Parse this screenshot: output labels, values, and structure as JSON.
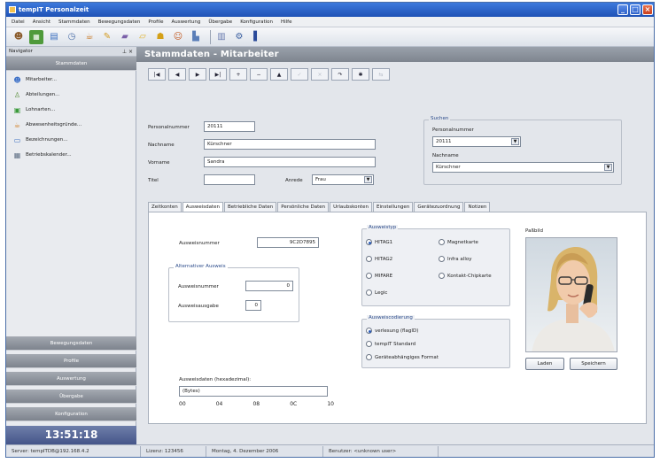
{
  "window": {
    "title": "tempIT Personalzeit",
    "controls": {
      "minimize": "_",
      "maximize": "□",
      "close": "×"
    }
  },
  "menu": [
    "Datei",
    "Ansicht",
    "Stammdaten",
    "Bewegungsdaten",
    "Profile",
    "Auswertung",
    "Übergabe",
    "Konfiguration",
    "Hilfe"
  ],
  "toolbar": {
    "icons": [
      "users-icon",
      "calendar-icon",
      "document-icon",
      "clock-icon",
      "coffee-icon",
      "pen-icon",
      "folder-icon",
      "folder-open-icon",
      "lock-icon",
      "people-icon",
      "chart-icon",
      "spacer-icon",
      "book-icon",
      "help-icon"
    ]
  },
  "navigator": {
    "header": "Navigator",
    "pin": "⊥ ×",
    "stammdaten_group": "Stammdaten",
    "items": [
      {
        "label": "Mitarbeiter...",
        "icon": "people-icon",
        "color": "#3b6fc7"
      },
      {
        "label": "Abteilungen...",
        "icon": "person-icon",
        "color": "#5a8f3c"
      },
      {
        "label": "Lohnarten...",
        "icon": "ledger-icon",
        "color": "#3a9a3a"
      },
      {
        "label": "Abwesenheitsgründe...",
        "icon": "absence-icon",
        "color": "#d07a1c"
      },
      {
        "label": "Bezeichnungen...",
        "icon": "label-icon",
        "color": "#3a6fc0"
      },
      {
        "label": "Betriebskalender...",
        "icon": "calendar-icon",
        "color": "#607086"
      }
    ],
    "groups": [
      "Bewegungsdaten",
      "Profile",
      "Auswertung",
      "Übergabe",
      "Konfiguration"
    ],
    "clock": "13:51:18"
  },
  "main": {
    "title": "Stammdaten - Mitarbeiter",
    "record_nav": [
      {
        "symbol": "|◀",
        "enabled": true
      },
      {
        "symbol": "◀",
        "enabled": true
      },
      {
        "symbol": "▶",
        "enabled": true
      },
      {
        "symbol": "▶|",
        "enabled": true
      },
      {
        "symbol": "+",
        "enabled": true
      },
      {
        "symbol": "−",
        "enabled": true
      },
      {
        "symbol": "▲",
        "enabled": true
      },
      {
        "symbol": "✓",
        "enabled": false
      },
      {
        "symbol": "×",
        "enabled": false
      },
      {
        "symbol": "↷",
        "enabled": true
      },
      {
        "symbol": "✱",
        "enabled": true
      },
      {
        "symbol": "⇆",
        "enabled": false
      }
    ],
    "form": {
      "personalnummer_label": "Personalnummer",
      "personalnummer": "20111",
      "nachname_label": "Nachname",
      "nachname": "Kürschner",
      "vorname_label": "Vorname",
      "vorname": "Sandra",
      "titel_label": "Titel",
      "titel": "",
      "anrede_label": "Anrede",
      "anrede": "Frau"
    },
    "suchen": {
      "title": "Suchen",
      "personalnummer_label": "Personalnummer",
      "personalnummer": "20111",
      "nachname_label": "Nachname",
      "nachname": "Kürschner"
    },
    "tabs": [
      "Zeitkonten",
      "Ausweisdaten",
      "Betriebliche Daten",
      "Persönliche Daten",
      "Urlaubskonten",
      "Einstellungen",
      "Gerätezuordnung",
      "Notizen"
    ],
    "active_tab": "Ausweisdaten",
    "ausweis": {
      "nummer_label": "Ausweisnummer",
      "nummer": "9C2D7895",
      "alt_group": "Alternativer Ausweis",
      "alt_nummer_label": "Ausweisnummer",
      "alt_nummer": "0",
      "ausgabe_label": "Ausweisausgabe",
      "ausgabe": "0",
      "typ_group": "Ausweistyp",
      "typ_options": [
        {
          "label": "HITAG1",
          "selected": true
        },
        {
          "label": "HITAG2",
          "selected": false
        },
        {
          "label": "MIFARE",
          "selected": false
        },
        {
          "label": "Legic",
          "selected": false
        },
        {
          "label": "Magnetkarte",
          "selected": false
        },
        {
          "label": "Infra alloy",
          "selected": false
        },
        {
          "label": "Kontakt-Chipkarte",
          "selected": false
        }
      ],
      "codierung_group": "Ausweiscodierung",
      "codierung_options": [
        {
          "label": "verlesung (flagID)",
          "selected": true
        },
        {
          "label": "tempIT Standard",
          "selected": false
        },
        {
          "label": "Geräteabhängiges Format",
          "selected": false
        }
      ],
      "hex_label": "Ausweisdaten (hexadezimal):",
      "hex_value": "(Bytes)",
      "hex_scale": [
        "00",
        "04",
        "08",
        "0C",
        "10"
      ]
    },
    "photo": {
      "label": "Paßbild",
      "load_button": "Laden",
      "save_button": "Speichern"
    }
  },
  "statusbar": {
    "server": "Server: tempITDB@192.168.4.2",
    "license": "Lizenz: 123456",
    "date": "Montag, 4. Dezember 2006",
    "user": "Benutzer: <unknown user>"
  },
  "colors": {
    "title_bar": "#2a5fc4",
    "nav_group": "#8e949c",
    "clock_bg": "#52608f",
    "radio_selected": "#2b5cb8"
  }
}
